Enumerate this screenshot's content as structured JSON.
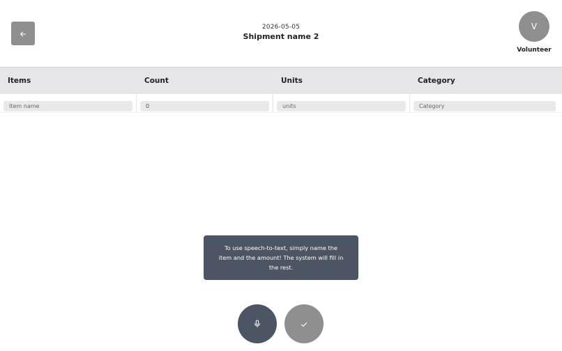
{
  "header": {
    "date": "2026-05-05",
    "title": "Shipment name 2",
    "back_icon": "arrow-left-icon"
  },
  "user": {
    "initial": "V",
    "name": "Volunteer"
  },
  "table": {
    "columns": [
      "Items",
      "Count",
      "Units",
      "Category"
    ],
    "row": {
      "item_placeholder": "Item name",
      "count_value": "0",
      "units_placeholder": "units",
      "category_placeholder": "Category"
    }
  },
  "tooltip": {
    "text": "To use speech-to-text, simply name the item and the amount! The system will fill in the rest."
  },
  "actions": {
    "mic_icon": "microphone-icon",
    "confirm_icon": "checkmark-icon"
  },
  "colors": {
    "gray_button": "#8f8f8f",
    "dark_slate": "#4b5563",
    "table_header": "#e6e6e9"
  }
}
